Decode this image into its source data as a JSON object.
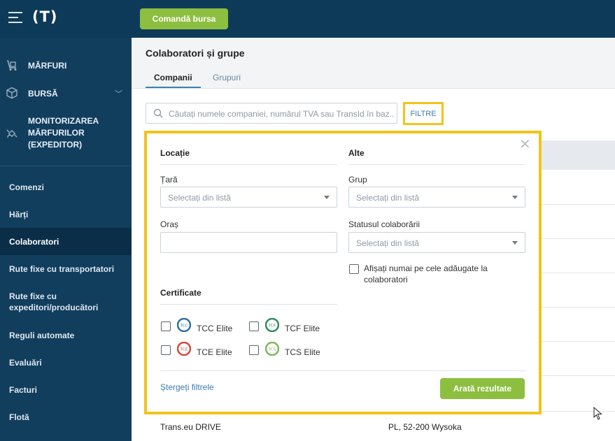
{
  "header": {
    "logo_text": "(T)",
    "action_button": "Comandă bursa"
  },
  "sidebar": {
    "modules": [
      {
        "label": "MĂRFURI",
        "icon": "trolley-icon"
      },
      {
        "label": "BURSĂ",
        "icon": "box-icon"
      },
      {
        "label": "MONITORIZAREA\nMĂRFURILOR\n(EXPEDITOR)",
        "icon": "satellite-icon"
      }
    ],
    "items": [
      {
        "label": "Comenzi"
      },
      {
        "label": "Hărți"
      },
      {
        "label": "Colaboratori",
        "active": true
      },
      {
        "label": "Rute fixe cu transportatori"
      },
      {
        "label": "Rute fixe cu expeditori/producători"
      },
      {
        "label": "Reguli automate"
      },
      {
        "label": "Evaluări"
      },
      {
        "label": "Facturi"
      },
      {
        "label": "Flotă"
      }
    ]
  },
  "main": {
    "title": "Colaboratori și grupe",
    "tabs": [
      {
        "label": "Companii",
        "active": true
      },
      {
        "label": "Grupuri",
        "active": false
      }
    ],
    "search": {
      "placeholder": "Căutați numele companiei, numărul TVA sau TransId în baz..."
    },
    "filter_button": "FILTRE",
    "background_row": {
      "name": "Trans.eu DRIVE",
      "address": "PL, 52-200 Wysoka"
    }
  },
  "filters": {
    "location": {
      "title": "Locație",
      "country_label": "Țară",
      "country_placeholder": "Selectați din listă",
      "city_label": "Oraș",
      "city_value": ""
    },
    "other": {
      "title": "Alte",
      "group_label": "Grup",
      "group_placeholder": "Selectați din listă",
      "status_label": "Statusul colaborării",
      "status_placeholder": "Selectați din listă",
      "only_added_label": "Afișați numai pe cele adăugate la colaboratori",
      "only_added_checked": false
    },
    "certificates": {
      "title": "Certificate",
      "items": [
        {
          "label": "TCC Elite",
          "badge": "TCC",
          "color": "#2e6f9e",
          "checked": false
        },
        {
          "label": "TCF Elite",
          "badge": "TCF",
          "color": "#2f8a5a",
          "checked": false
        },
        {
          "label": "TCE Elite",
          "badge": "TCE",
          "color": "#d24a3c",
          "checked": false
        },
        {
          "label": "TCS Elite",
          "badge": "TCS",
          "color": "#7ab85a",
          "checked": false
        }
      ]
    },
    "clear_label": "Ștergeți filtrele",
    "show_results_label": "Arată rezultate"
  },
  "colors": {
    "sidebar_bg": "#123e5e",
    "topbar_bg": "#0e3a5a",
    "accent_green": "#8cbf3f",
    "highlight_yellow": "#f2c31b",
    "link_blue": "#3d7ab0"
  }
}
